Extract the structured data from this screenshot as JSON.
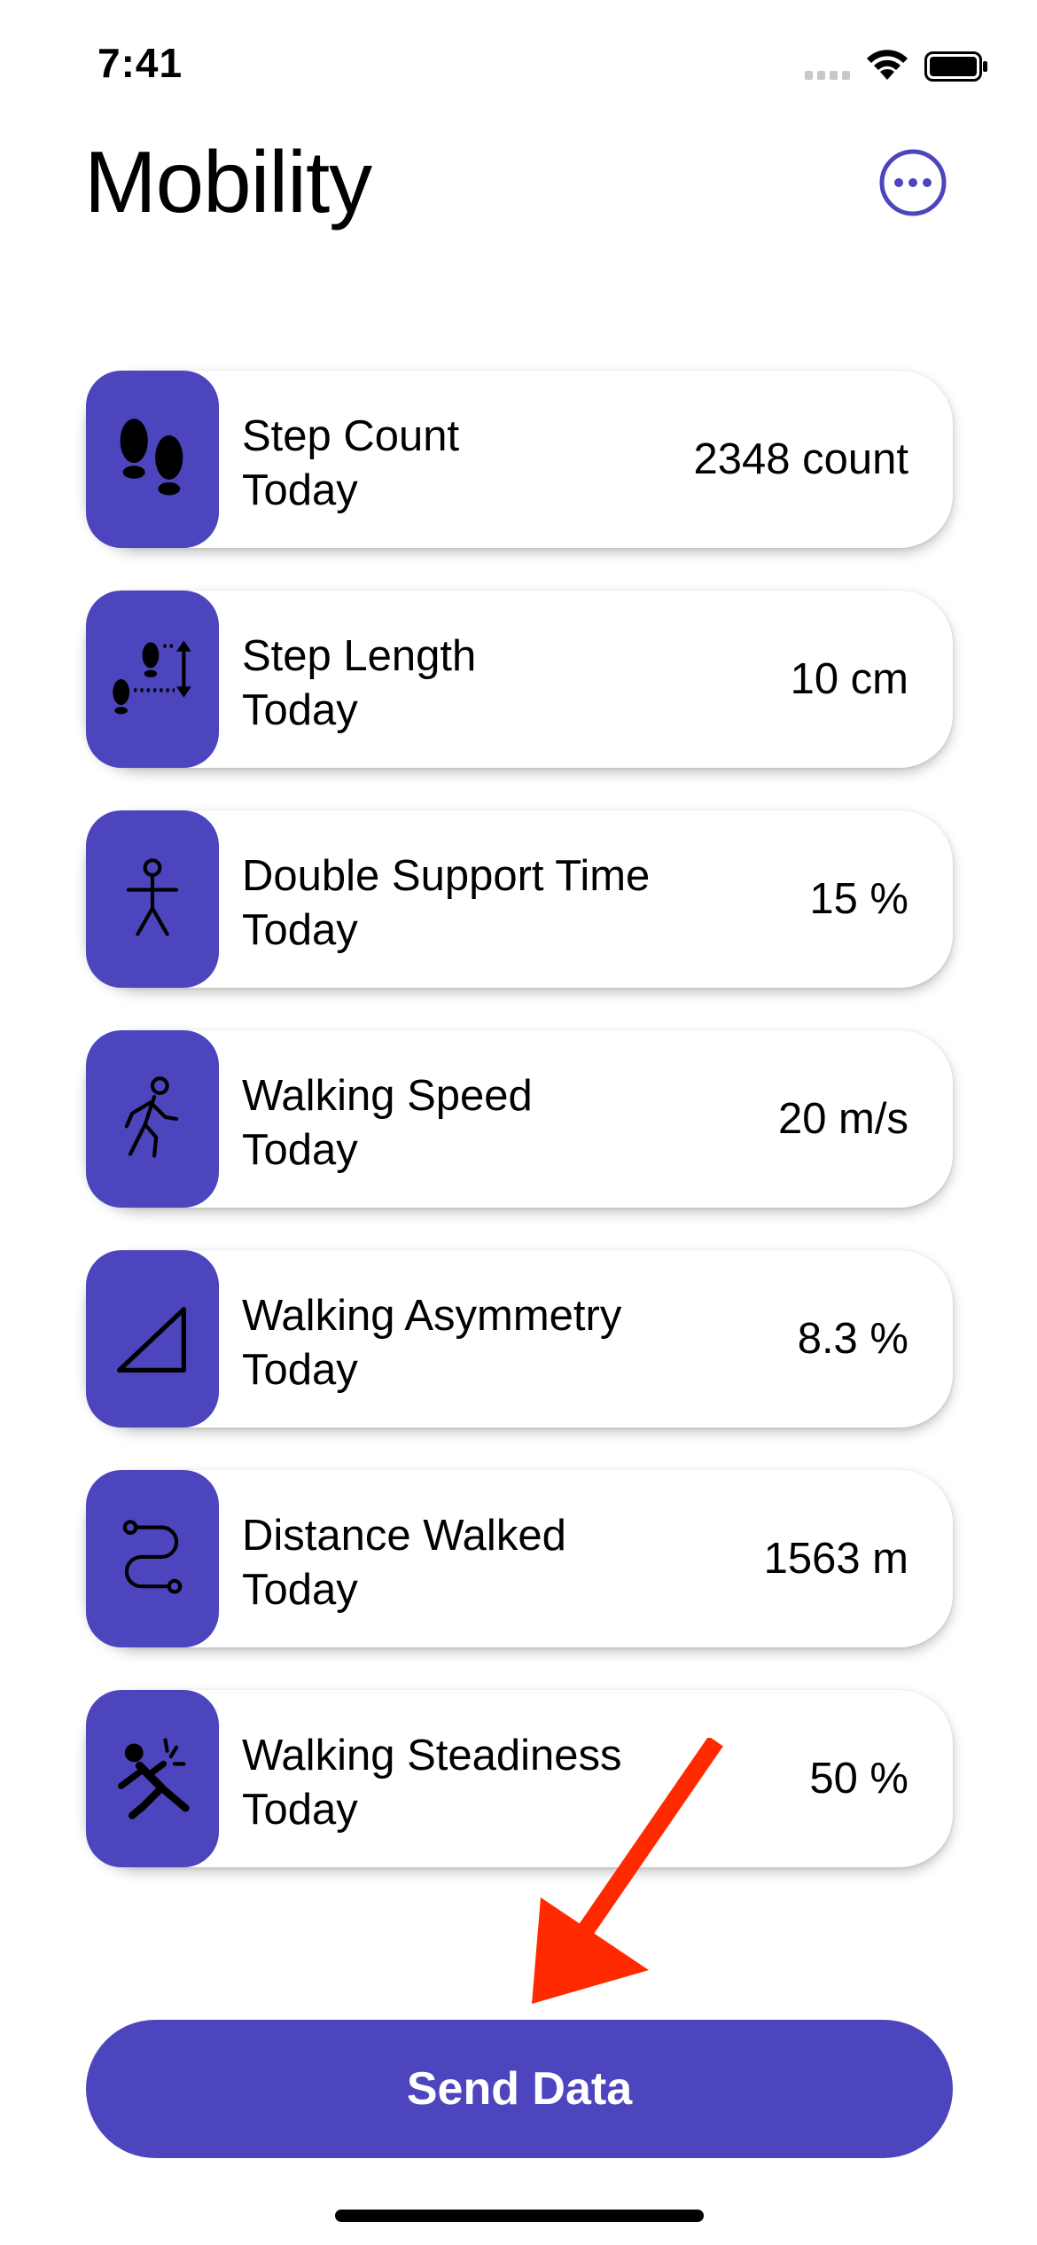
{
  "status_bar": {
    "time": "7:41"
  },
  "header": {
    "title": "Mobility",
    "more_icon": "ellipsis-circle-icon"
  },
  "metrics": [
    {
      "title": "Step Count",
      "subtitle": "Today",
      "value": "2348 count",
      "icon": "footprints-icon"
    },
    {
      "title": "Step Length",
      "subtitle": "Today",
      "value": "10 cm",
      "icon": "step-length-icon"
    },
    {
      "title": "Double Support Time",
      "subtitle": "Today",
      "value": "15 %",
      "icon": "standing-figure-icon"
    },
    {
      "title": "Walking Speed",
      "subtitle": "Today",
      "value": "20 m/s",
      "icon": "walking-figure-icon"
    },
    {
      "title": "Walking Asymmetry",
      "subtitle": "Today",
      "value": "8.3 %",
      "icon": "triangle-icon"
    },
    {
      "title": "Distance Walked",
      "subtitle": "Today",
      "value": "1563 m",
      "icon": "path-icon"
    },
    {
      "title": "Walking Steadiness",
      "subtitle": "Today",
      "value": "50 %",
      "icon": "falling-figure-icon"
    }
  ],
  "footer": {
    "send_label": "Send Data"
  },
  "colors": {
    "accent": "#4c45bd",
    "annotation_arrow": "#ff2a00"
  }
}
